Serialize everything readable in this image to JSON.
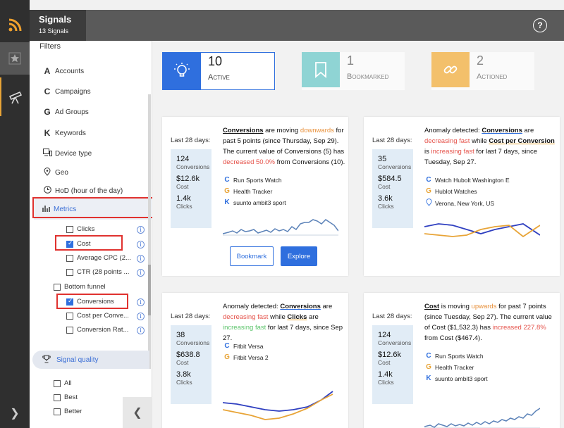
{
  "header": {
    "title": "Signals",
    "subtitle": "13 Signals",
    "help": "?"
  },
  "sidebar": {
    "filters_label": "Filters",
    "items": [
      {
        "label": "Accounts",
        "icon": "A"
      },
      {
        "label": "Campaigns",
        "icon": "C"
      },
      {
        "label": "Ad Groups",
        "icon": "G"
      },
      {
        "label": "Keywords",
        "icon": "K"
      },
      {
        "label": "Device type",
        "icon": "device-icon"
      },
      {
        "label": "Geo",
        "icon": "pin-icon"
      },
      {
        "label": "HoD (hour of the day)",
        "icon": "clock-icon"
      }
    ],
    "metrics_label": "Metrics",
    "metric_options": [
      {
        "label": "Clicks",
        "checked": false
      },
      {
        "label": "Cost",
        "checked": true
      },
      {
        "label": "Average CPC (2...",
        "checked": false
      },
      {
        "label": "CTR (28 points ...",
        "checked": false
      }
    ],
    "bottom_funnel_label": "Bottom funnel",
    "funnel_options": [
      {
        "label": "Conversions",
        "checked": true
      },
      {
        "label": "Cost per Conve...",
        "checked": false
      },
      {
        "label": "Conversion Rat...",
        "checked": false
      }
    ],
    "signal_quality_label": "Signal quality",
    "quality_options": [
      "All",
      "Best",
      "Better"
    ]
  },
  "stats": [
    {
      "value": "10",
      "label": "Active"
    },
    {
      "value": "1",
      "label": "Bookmarked"
    },
    {
      "value": "2",
      "label": "Actioned"
    }
  ],
  "cards": [
    {
      "last": "Last 28 days:",
      "kpis": [
        {
          "v": "124",
          "l": "Conversions"
        },
        {
          "v": "$12.6k",
          "l": "Cost"
        },
        {
          "v": "1.4k",
          "l": "Clicks"
        }
      ],
      "desc": {
        "metric": "Conversions",
        "t1": " are moving ",
        "dir": "downwards",
        "t2": " for past 5 points (since Thursday, Sep 29). The current value of Conversions (5) has ",
        "change": "decreased 50.0%",
        "t3": " from Conversions (10)."
      },
      "entities": [
        {
          "icon": "C",
          "label": "Run Sports Watch"
        },
        {
          "icon": "G",
          "label": "Health Tracker"
        },
        {
          "icon": "K",
          "label": "suunto ambit3 sport"
        }
      ],
      "bookmark_label": "Bookmark",
      "explore_label": "Explore"
    },
    {
      "last": "Last 28 days:",
      "kpis": [
        {
          "v": "35",
          "l": "Conversions"
        },
        {
          "v": "$584.5",
          "l": "Cost"
        },
        {
          "v": "3.6k",
          "l": "Clicks"
        }
      ],
      "desc": {
        "t0": "Anomaly detected: ",
        "m1": "Conversions",
        "t1": " are ",
        "s1": "decreasing fast",
        "t2": " while ",
        "m2": "Cost per Conversion",
        "t3": " is ",
        "s2": "increasing fast",
        "t4": " for last 7 days, since Tuesday, Sep 27."
      },
      "entities": [
        {
          "icon": "C",
          "label": "Watch Hubolt Washington E"
        },
        {
          "icon": "G",
          "label": "Hublot Watches"
        },
        {
          "icon": "pin-icon",
          "label": "Verona, New York, US"
        }
      ]
    },
    {
      "last": "Last 28 days:",
      "kpis": [
        {
          "v": "38",
          "l": "Conversions"
        },
        {
          "v": "$638.8",
          "l": "Cost"
        },
        {
          "v": "3.8k",
          "l": "Clicks"
        }
      ],
      "desc": {
        "t0": "Anomaly detected: ",
        "m1": "Conversions",
        "t1": " are ",
        "s1": "decreasing fast",
        "t2": " while ",
        "m2": "Clicks",
        "t3": " are ",
        "s2": "increasing fast",
        "t4": " for last 7 days, since Sep 27."
      },
      "entities": [
        {
          "icon": "C",
          "label": "Fitbit Versa"
        },
        {
          "icon": "G",
          "label": "Fitbit Versa 2"
        }
      ]
    },
    {
      "last": "Last 28 days:",
      "kpis": [
        {
          "v": "124",
          "l": "Conversions"
        },
        {
          "v": "$12.6k",
          "l": "Cost"
        },
        {
          "v": "1.4k",
          "l": "Clicks"
        }
      ],
      "desc": {
        "metric": "Cost",
        "t1": " is moving ",
        "dir": "upwards",
        "t2": " for past 7 points (since Tuesday, Sep 27). The current value of Cost ($1,532.3) has ",
        "change": "increased 227.8%",
        "t3": " from Cost ($467.4)."
      },
      "entities": [
        {
          "icon": "C",
          "label": "Run Sports Watch"
        },
        {
          "icon": "G",
          "label": "Health Tracker"
        },
        {
          "icon": "K",
          "label": "suunto ambit3 sport"
        }
      ]
    }
  ],
  "colors": {
    "accent": "#2f6fde",
    "highlight": "#e0322f",
    "orange": "#e8a437",
    "red": "#e5534b",
    "green": "#5cc46b"
  }
}
